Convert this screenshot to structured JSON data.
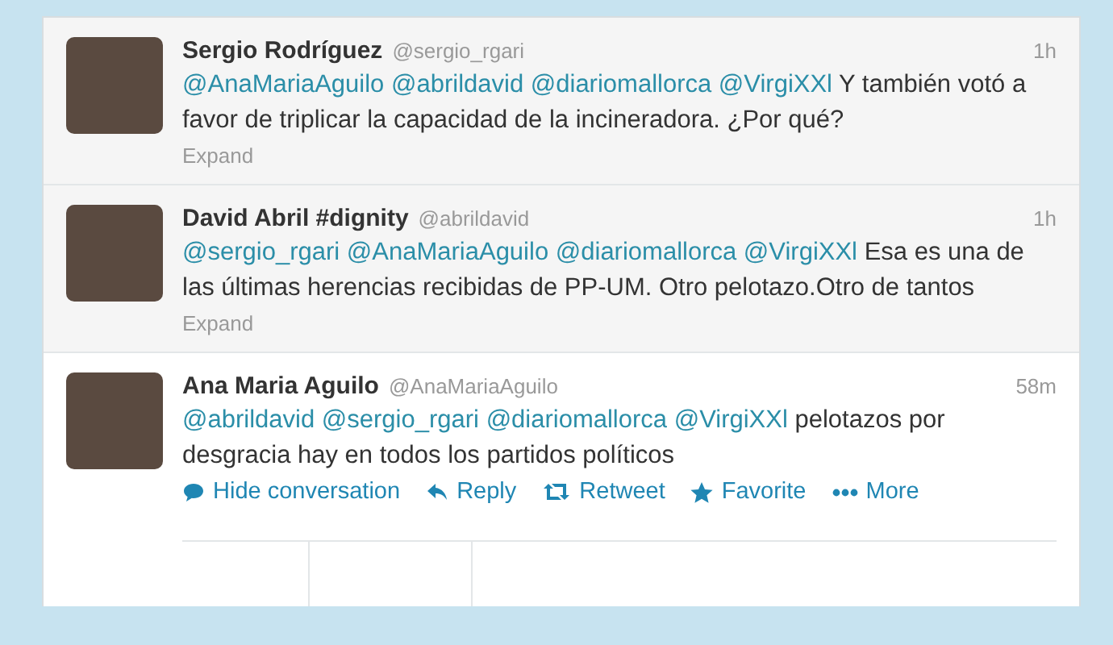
{
  "tweets": [
    {
      "name": "Sergio Rodríguez",
      "handle": "@sergio_rgari",
      "time": "1h",
      "mentions": [
        "@AnaMariaAguilo",
        "@abrildavid",
        "@diariomallorca",
        "@VirgiXXl"
      ],
      "body": "Y también votó a favor de triplicar la capacidad de la incineradora. ¿Por qué?",
      "expanded": false,
      "actions": [
        {
          "kind": "expand",
          "label": "Expand"
        }
      ]
    },
    {
      "name": "David Abril #dignity",
      "handle": "@abrildavid",
      "time": "1h",
      "mentions": [
        "@sergio_rgari",
        "@AnaMariaAguilo",
        "@diariomallorca",
        "@VirgiXXl"
      ],
      "body": "Esa es una de las últimas herencias recibidas de PP-UM. Otro pelotazo.Otro de tantos",
      "expanded": false,
      "actions": [
        {
          "kind": "expand",
          "label": "Expand"
        }
      ]
    },
    {
      "name": "Ana Maria Aguilo",
      "handle": "@AnaMariaAguilo",
      "time": "58m",
      "mentions": [
        "@abrildavid",
        "@sergio_rgari",
        "@diariomallorca",
        "@VirgiXXl"
      ],
      "body": "pelotazos por desgracia hay en todos los partidos políticos",
      "expanded": true,
      "actions": [
        {
          "kind": "conversation",
          "label": "Hide conversation"
        },
        {
          "kind": "reply",
          "label": "Reply"
        },
        {
          "kind": "retweet",
          "label": "Retweet"
        },
        {
          "kind": "favorite",
          "label": "Favorite"
        },
        {
          "kind": "more",
          "label": "More"
        }
      ]
    }
  ]
}
